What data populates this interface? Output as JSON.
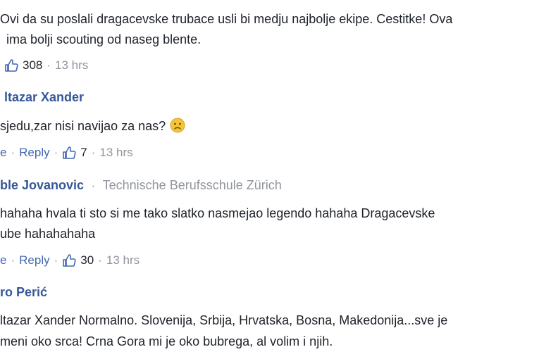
{
  "comments": [
    {
      "lines": [
        "Ovi da su poslali dragacevske trubace usli bi medju najbolje ekipe. Cestitke! Ova",
        "ima bolji scouting od naseg blente."
      ],
      "likes": "308",
      "time": "13 hrs"
    },
    {
      "author": "ltazar Xander",
      "lines": [
        "sjedu,zar nisi navijao za nas?"
      ],
      "emoji": "sad-face-emoji",
      "like_label": "e",
      "reply_label": "Reply",
      "likes": "7",
      "time": "13 hrs"
    },
    {
      "author": "ble Jovanovic",
      "school": "Technische Berufsschule Zürich",
      "lines": [
        "hahaha hvala ti sto si me tako slatko nasmejao legendo hahaha Dragacevske",
        "ube hahahahaha"
      ],
      "like_label": "e",
      "reply_label": "Reply",
      "likes": "30",
      "time": "13 hrs"
    },
    {
      "author": "ro Perić",
      "lines": [
        "ltazar Xander Normalno. Slovenija, Srbija, Hrvatska, Bosna, Makedonija...sve je",
        "meni oko srca! Crna Gora mi je oko bubrega, al volim i njih."
      ]
    }
  ],
  "separator": "·",
  "colors": {
    "name": "#365899",
    "link": "#4267b2",
    "meta": "#90949c",
    "text": "#1d2129"
  }
}
